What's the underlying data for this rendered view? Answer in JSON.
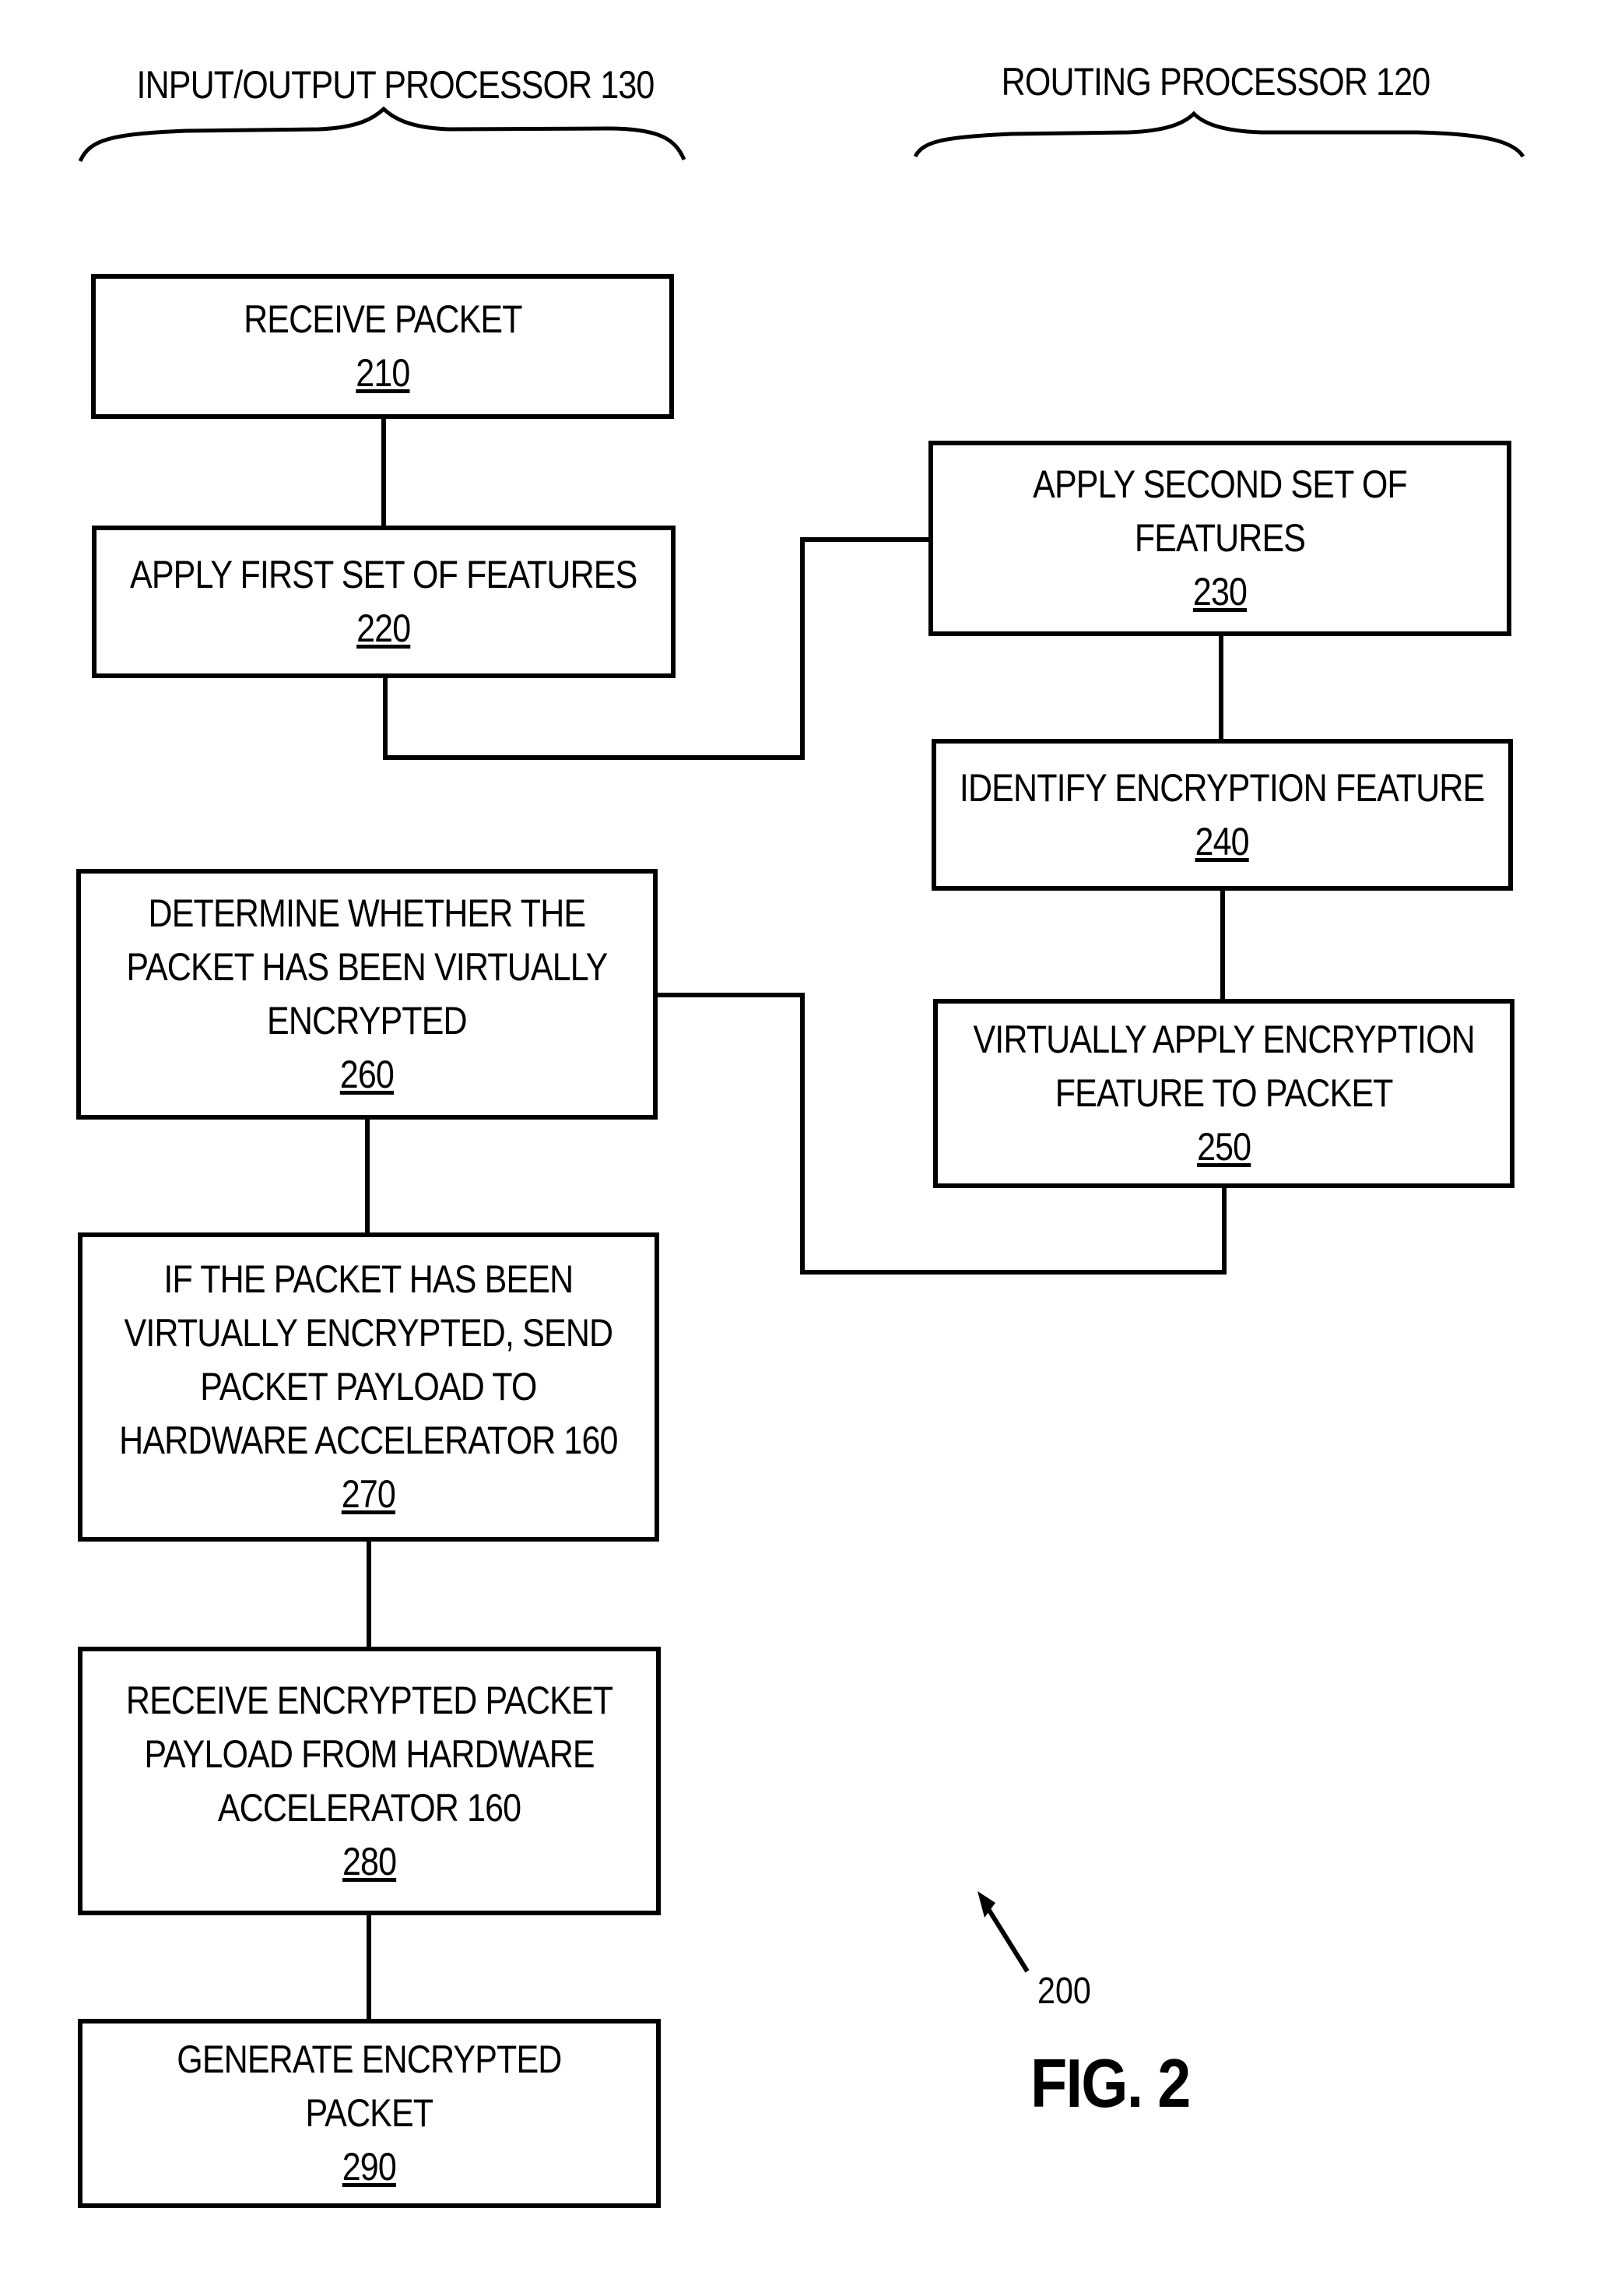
{
  "figure": {
    "label": "FIG. 2",
    "reference_number": "200"
  },
  "lanes": [
    {
      "id": "io",
      "title": "INPUT/OUTPUT PROCESSOR 130"
    },
    {
      "id": "routing",
      "title": "ROUTING PROCESSOR 120"
    }
  ],
  "steps": {
    "s210": {
      "lane": "io",
      "lines": [
        "RECEIVE PACKET"
      ],
      "ref": "210"
    },
    "s220": {
      "lane": "io",
      "lines": [
        "APPLY FIRST SET OF FEATURES"
      ],
      "ref": "220"
    },
    "s230": {
      "lane": "routing",
      "lines": [
        "APPLY SECOND SET OF",
        "FEATURES"
      ],
      "ref": "230"
    },
    "s240": {
      "lane": "routing",
      "lines": [
        "IDENTIFY ENCRYPTION FEATURE"
      ],
      "ref": "240"
    },
    "s250": {
      "lane": "routing",
      "lines": [
        "VIRTUALLY APPLY ENCRYPTION",
        "FEATURE TO PACKET"
      ],
      "ref": "250"
    },
    "s260": {
      "lane": "io",
      "lines": [
        "DETERMINE WHETHER THE",
        "PACKET HAS BEEN VIRTUALLY",
        "ENCRYPTED"
      ],
      "ref": "260"
    },
    "s270": {
      "lane": "io",
      "lines": [
        "IF THE PACKET HAS BEEN",
        "VIRTUALLY ENCRYPTED, SEND",
        "PACKET PAYLOAD TO",
        "HARDWARE ACCELERATOR 160"
      ],
      "ref": "270"
    },
    "s280": {
      "lane": "io",
      "lines": [
        "RECEIVE ENCRYPTED PACKET",
        "PAYLOAD FROM HARDWARE",
        "ACCELERATOR 160"
      ],
      "ref": "280"
    },
    "s290": {
      "lane": "io",
      "lines": [
        "GENERATE ENCRYPTED",
        "PACKET"
      ],
      "ref": "290"
    }
  },
  "connections": [
    [
      "210",
      "220"
    ],
    [
      "220",
      "230"
    ],
    [
      "230",
      "240"
    ],
    [
      "240",
      "250"
    ],
    [
      "250",
      "260"
    ],
    [
      "260",
      "270"
    ],
    [
      "270",
      "280"
    ],
    [
      "280",
      "290"
    ]
  ]
}
